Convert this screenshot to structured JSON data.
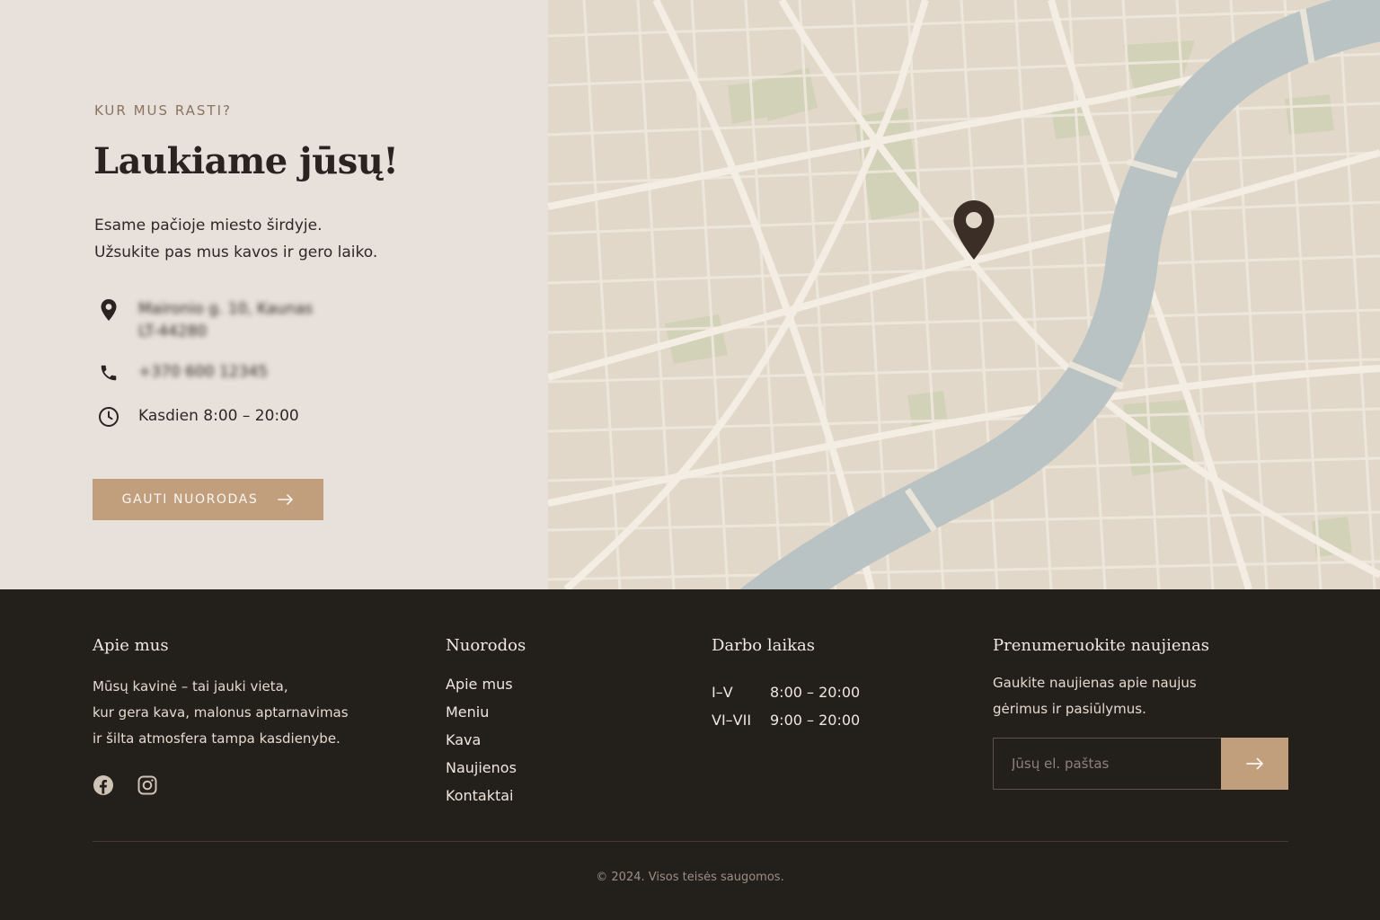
{
  "location": {
    "eyebrow": "KUR MUS RASTI?",
    "headline": "Laukiame jūsų!",
    "intro": [
      "Esame pačioje miesto širdyje.",
      "Užsukite pas mus kavos ir gero laiko."
    ],
    "address": [
      "Maironio g. 10, Kaunas",
      "LT-44280"
    ],
    "phone": "+370 600 12345",
    "hours": "Kasdien 8:00 – 20:00",
    "cta_label": "GAUTI NUORODAS",
    "icons": {
      "address": "map-pin-icon",
      "phone": "phone-icon",
      "hours": "clock-icon",
      "cta": "arrow-right-icon"
    }
  },
  "map": {
    "marker": "map-pin-icon",
    "river_color": "#b9c3c4",
    "land_color": "#e2d8c9",
    "park_color": "#c9cfb0"
  },
  "footer": {
    "about": {
      "title": "Apie mus",
      "text": [
        "Mūsų kavinė – tai jauki vieta,",
        "kur gera kava, malonus aptarnavimas",
        "ir šilta atmosfera tampa kasdienybe."
      ],
      "social": [
        "facebook-icon",
        "instagram-icon"
      ]
    },
    "links": {
      "title": "Nuorodos",
      "items": [
        "Apie mus",
        "Meniu",
        "Kava",
        "Naujienos",
        "Kontaktai"
      ]
    },
    "hours": {
      "title": "Darbo laikas",
      "rows": [
        {
          "days": "I–V",
          "time": "8:00 – 20:00"
        },
        {
          "days": "VI–VII",
          "time": "9:00 – 20:00"
        }
      ]
    },
    "newsletter": {
      "title": "Prenumeruokite naujienas",
      "text": [
        "Gaukite naujienas apie naujus",
        "gėrimus ir pasiūlymus."
      ],
      "placeholder": "Jūsų el. paštas",
      "submit_icon": "arrow-right-icon"
    },
    "copyright": "© 2024. Visos teisės saugomos."
  },
  "colors": {
    "accent": "#c19f7d",
    "dark": "#231f1b",
    "panel": "#e8e0da"
  }
}
